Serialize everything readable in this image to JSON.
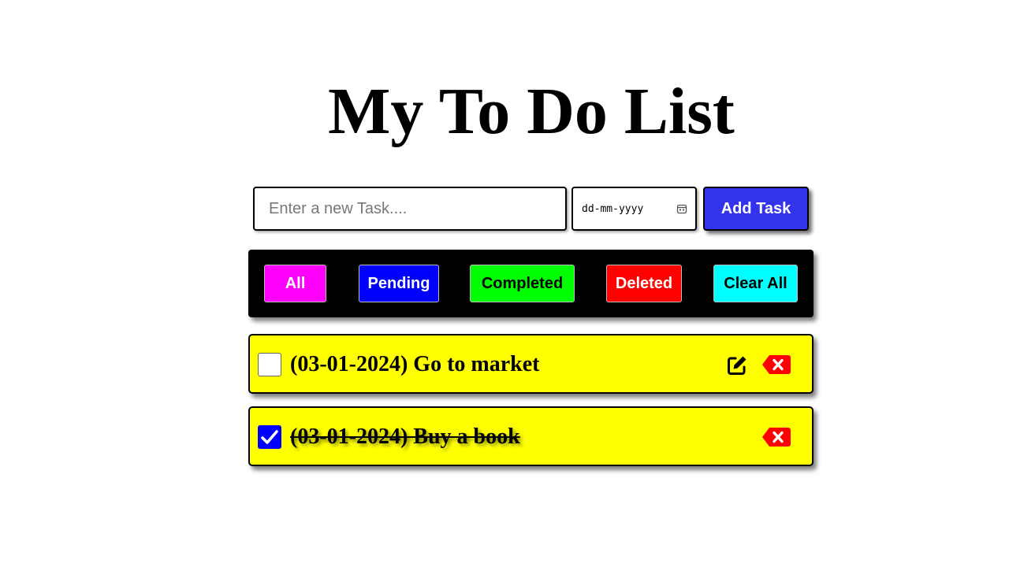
{
  "title": "My To Do List",
  "form": {
    "task_placeholder": "Enter a new Task....",
    "date_placeholder": "dd-mm-yyyy",
    "add_label": "Add Task"
  },
  "filters": [
    {
      "label": "All",
      "bg": "#ff00ff",
      "color": "#ffffff"
    },
    {
      "label": "Pending",
      "bg": "#0000ff",
      "color": "#ffffff"
    },
    {
      "label": "Completed",
      "bg": "#00ff00",
      "color": "#000000"
    },
    {
      "label": "Deleted",
      "bg": "#ff0000",
      "color": "#ffffff"
    },
    {
      "label": "Clear All",
      "bg": "#00ffff",
      "color": "#000000"
    }
  ],
  "tasks": [
    {
      "text": "(03-01-2024) Go to market",
      "completed": false
    },
    {
      "text": "(03-01-2024) Buy a book",
      "completed": true
    }
  ],
  "colors": {
    "add_button": "#3333ee",
    "task_bg": "#ffff00",
    "delete_icon": "#ff0000",
    "checkbox_checked": "#0000ff",
    "filter_bar": "#000000"
  },
  "icons": {
    "edit": "pen-to-square-icon",
    "delete": "delete-left-icon",
    "calendar": "calendar-icon",
    "check": "checkmark-icon"
  }
}
